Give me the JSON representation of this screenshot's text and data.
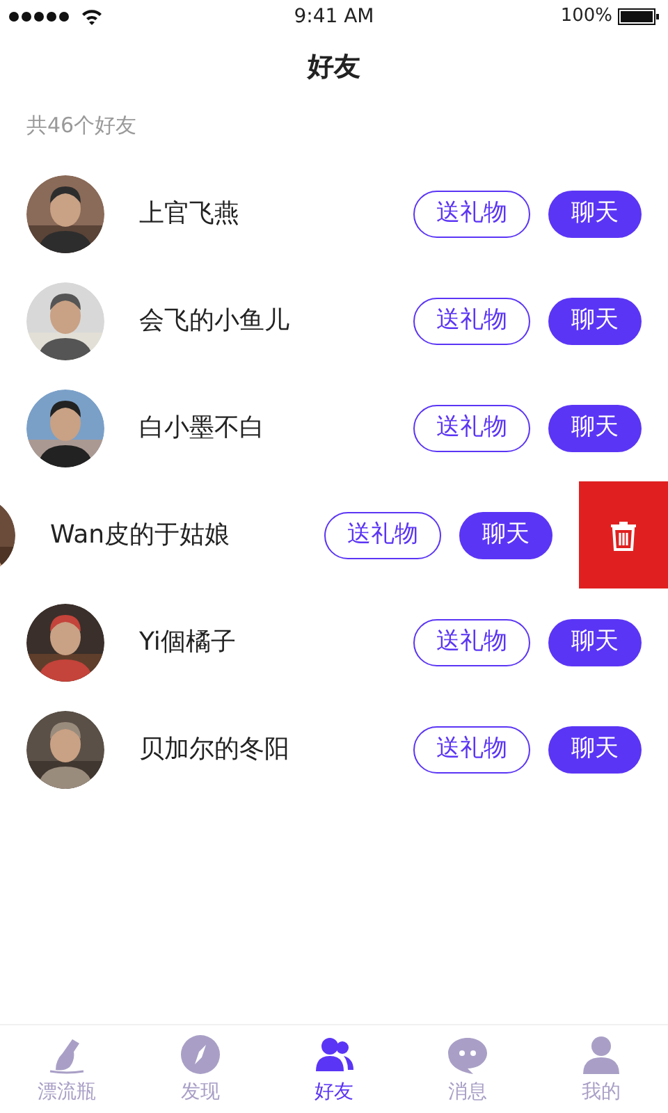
{
  "status_bar": {
    "time": "9:41 AM",
    "battery": "100%"
  },
  "title": "好友",
  "count": "共46个好友",
  "friends": [
    {
      "name": "上官飞燕",
      "gift": "送礼物",
      "chat": "聊天",
      "swiped": false
    },
    {
      "name": "会飞的小鱼儿",
      "gift": "送礼物",
      "chat": "聊天",
      "swiped": false
    },
    {
      "name": "白小墨不白",
      "gift": "送礼物",
      "chat": "聊天",
      "swiped": false
    },
    {
      "name": "Wan皮的于姑娘",
      "gift": "送礼物",
      "chat": "聊天",
      "swiped": true
    },
    {
      "name": "Yi個橘子",
      "gift": "送礼物",
      "chat": "聊天",
      "swiped": false
    },
    {
      "name": "贝加尔的冬阳",
      "gift": "送礼物",
      "chat": "聊天",
      "swiped": false
    }
  ],
  "tab_bar": [
    {
      "kind": "bottle",
      "label": "漂流瓶",
      "selected": false
    },
    {
      "kind": "compass",
      "label": "发现",
      "selected": false
    },
    {
      "kind": "friends",
      "label": "好友",
      "selected": true
    },
    {
      "kind": "chat",
      "label": "消息",
      "selected": false
    },
    {
      "kind": "person",
      "label": "我的",
      "selected": false
    }
  ]
}
